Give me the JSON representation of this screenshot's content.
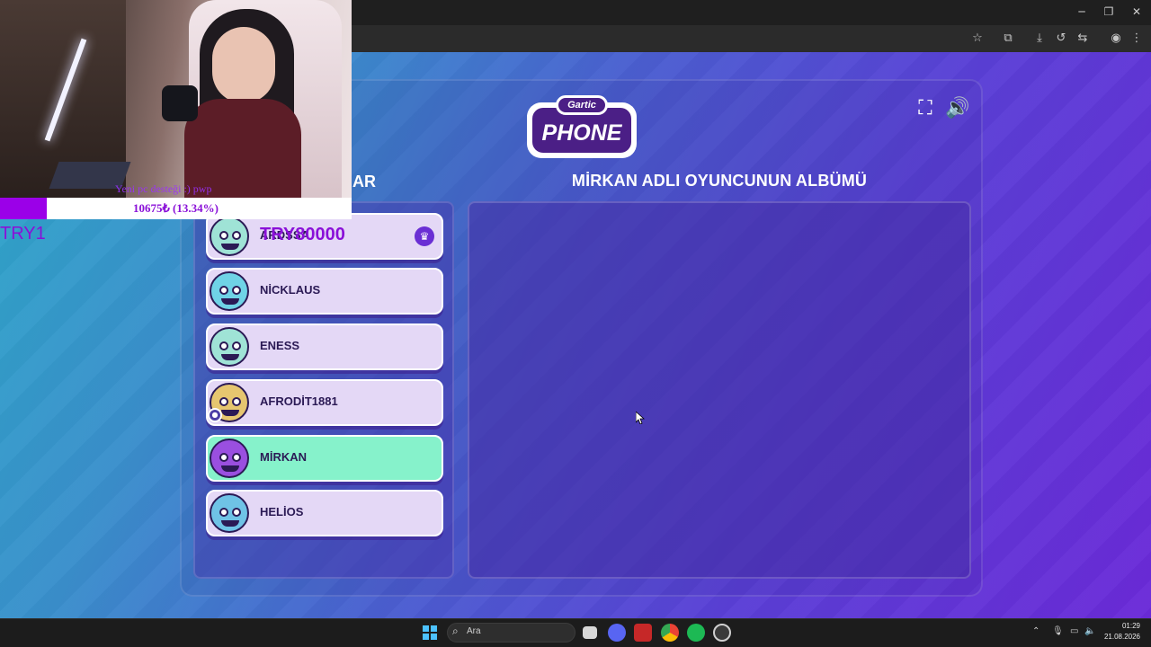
{
  "browser": {
    "minimize": "─",
    "restore": "❐",
    "close": "✕",
    "toolbar_icons": [
      "star-icon",
      "extensions-icon",
      "download-icon",
      "history-icon",
      "translate-icon",
      "profile-icon",
      "menu-icon"
    ]
  },
  "game": {
    "logo_top": "Gartic",
    "logo_main": "PHONE",
    "players_title": "AR",
    "album_title": "MİRKAN ADLI OYUNCUNUN ALBÜMÜ",
    "players": [
      {
        "name": "ARDSSA",
        "avatar_color": "#9fe3d6",
        "host": true,
        "active": false
      },
      {
        "name": "NİCKLAUS",
        "avatar_color": "#6fd3e6",
        "host": false,
        "active": false
      },
      {
        "name": "ENESS",
        "avatar_color": "#9fe3d6",
        "host": false,
        "active": false
      },
      {
        "name": "AFRODİT1881",
        "avatar_color": "#e6c66f",
        "host": false,
        "active": false,
        "guest": true
      },
      {
        "name": "MİRKAN",
        "avatar_color": "#9a4fe0",
        "host": false,
        "active": true
      },
      {
        "name": "HELİOS",
        "avatar_color": "#6fc3e6",
        "host": false,
        "active": false
      }
    ]
  },
  "stream": {
    "donation_text": "Yeni pc desteği :) pwp",
    "donation_amount": "10675₺ (13.34%)",
    "donation_progress": 0.1334,
    "try_label": "TRY1",
    "try_goal": "TRY80000",
    "accent": "#9b00e8"
  },
  "taskbar": {
    "search_label": "Ara",
    "time": "01:29",
    "date": "21.08.2026"
  }
}
